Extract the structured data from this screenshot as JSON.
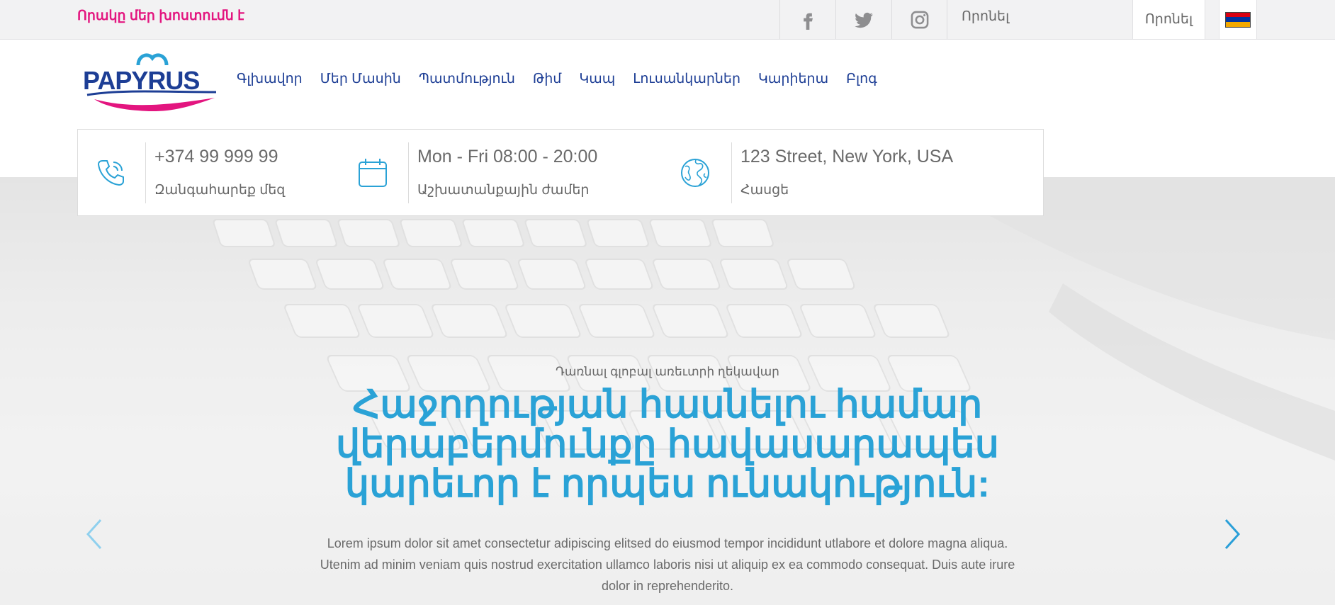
{
  "topbar": {
    "tagline": "Որակը մեր խոստումն է",
    "search_label": "Որոնել",
    "search_button": "Որոնել",
    "social": [
      {
        "icon": "facebook-icon"
      },
      {
        "icon": "twitter-icon"
      },
      {
        "icon": "instagram-icon"
      }
    ],
    "language_flag": "armenian-flag"
  },
  "header": {
    "logo_text": "PAPYRUS",
    "nav": [
      {
        "label": "Գլխավոր"
      },
      {
        "label": "Մեր Մասին"
      },
      {
        "label": "Պատմություն"
      },
      {
        "label": "Թիմ"
      },
      {
        "label": "Կապ"
      },
      {
        "label": "Լուսանկարներ"
      },
      {
        "label": "Կարիերա"
      },
      {
        "label": "Բլոգ"
      }
    ]
  },
  "info": {
    "phone": {
      "value": "+374 99 999 99",
      "label": "Զանգահարեք մեզ",
      "icon": "phone-icon"
    },
    "hours": {
      "value": "Mon - Fri 08:00 - 20:00",
      "label": "Աշխատանքային ժամեր",
      "icon": "calendar-icon"
    },
    "address": {
      "value": "123 Street, New York, USA",
      "label": "Հասցե",
      "icon": "globe-icon"
    }
  },
  "hero": {
    "eyebrow": "Դառնալ գլոբալ առեւտրի ղեկավար",
    "headline": "Հաջողության հասնելու համար վերաբերմունքը հավասարապես կարեւոր է որպես ունակություն:",
    "body": "Lorem ipsum dolor sit amet consectetur adipiscing elitsed do eiusmod tempor incididunt utlabore et dolore magna aliqua. Utenim ad minim veniam quis nostrud exercitation ullamco laboris nisi ut aliquip ex ea commodo consequat. Duis aute irure dolor in reprehenderito."
  },
  "colors": {
    "accent": "#2aa2d6",
    "tagline": "#e3157f",
    "nav": "#1d3e95",
    "flag": [
      "#d90012",
      "#0033a0",
      "#f2a800"
    ]
  }
}
